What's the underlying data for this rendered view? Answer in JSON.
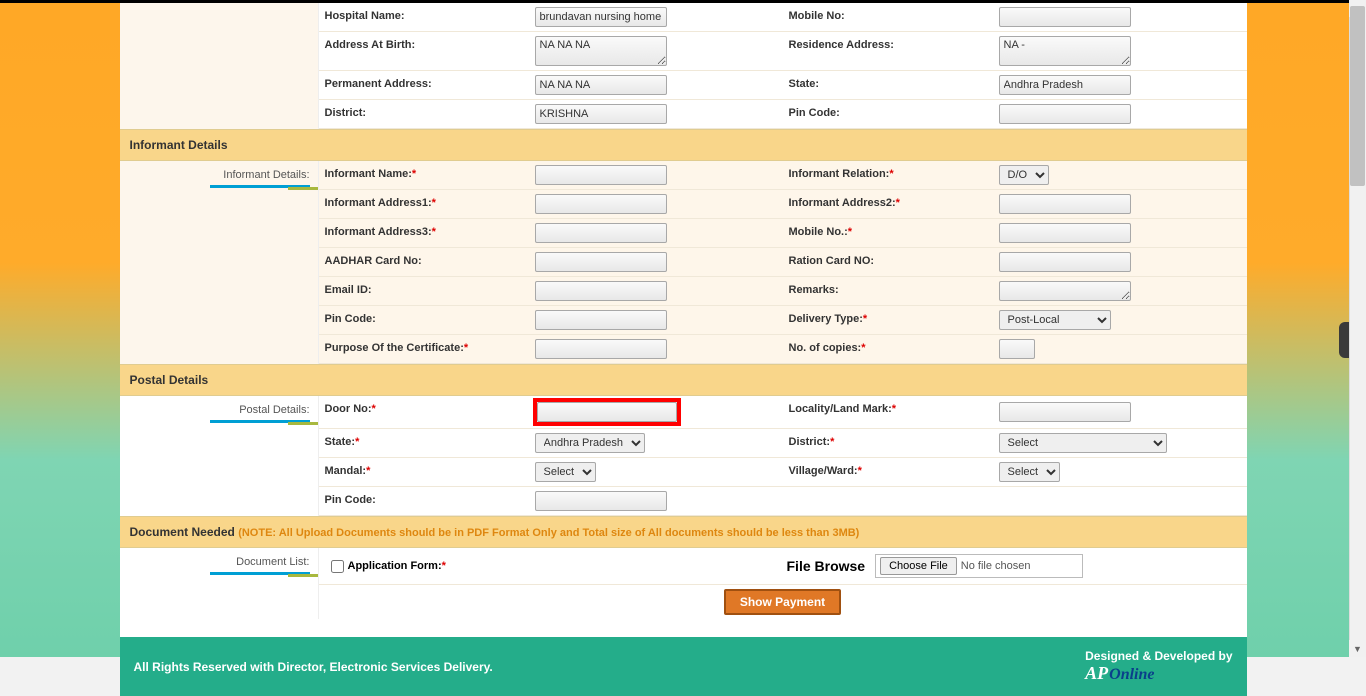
{
  "hospital": {
    "labels": {
      "hospital_name": "Hospital Name:",
      "mobile_no": "Mobile No:",
      "address_at_birth": "Address At Birth:",
      "residence_address": "Residence Address:",
      "permanent_address": "Permanent Address:",
      "state": "State:",
      "district": "District:",
      "pin_code": "Pin Code:"
    },
    "values": {
      "hospital_name": "brundavan nursing home",
      "mobile_no": "",
      "address_at_birth": "NA NA NA",
      "residence_address": "NA -",
      "permanent_address": "NA NA NA",
      "state": "Andhra Pradesh",
      "district": "KRISHNA",
      "pin_code": ""
    }
  },
  "informant_header": "Informant Details",
  "informant_side": "Informant Details:",
  "informant": {
    "labels": {
      "name": "Informant Name:",
      "relation": "Informant Relation:",
      "address1": "Informant Address1:",
      "address2": "Informant Address2:",
      "address3": "Informant Address3:",
      "mobile": "Mobile No.:",
      "aadhar": "AADHAR Card No:",
      "ration": "Ration Card NO:",
      "email": "Email ID:",
      "remarks": "Remarks:",
      "pin": "Pin Code:",
      "delivery_type": "Delivery Type:",
      "purpose": "Purpose Of the Certificate:",
      "copies": "No. of copies:"
    },
    "values": {
      "name": "",
      "relation_selected": "D/O",
      "address1": "",
      "address2": "",
      "address3": "",
      "mobile": "",
      "aadhar": "",
      "ration": "",
      "email": "",
      "remarks": "",
      "pin": "",
      "delivery_type_selected": "Post-Local",
      "purpose": "",
      "copies": ""
    }
  },
  "postal_header": "Postal Details",
  "postal_side": "Postal Details:",
  "postal": {
    "labels": {
      "door_no": "Door No:",
      "locality": "Locality/Land Mark:",
      "state": "State:",
      "district": "District:",
      "mandal": "Mandal:",
      "village": "Village/Ward:",
      "pin": "Pin Code:"
    },
    "values": {
      "door_no": "",
      "locality": "",
      "state_selected": "Andhra Pradesh",
      "district_selected": "Select",
      "mandal_selected": "Select",
      "village_selected": "Select",
      "pin": ""
    }
  },
  "documents": {
    "header": "Document Needed",
    "note": "(NOTE: All Upload Documents should be in PDF Format Only and Total size of All documents should be less than 3MB)",
    "side": "Document List:",
    "app_form_label": "Application Form:",
    "file_browse_label": "File Browse",
    "choose_file_btn": "Choose File",
    "no_file": "No file chosen"
  },
  "show_payment_btn": "Show Payment",
  "footer": {
    "left": "All Rights Reserved with Director, Electronic Services Delivery.",
    "right": "Designed & Developed by",
    "logo_ap": "AP",
    "logo_online": "Online"
  }
}
